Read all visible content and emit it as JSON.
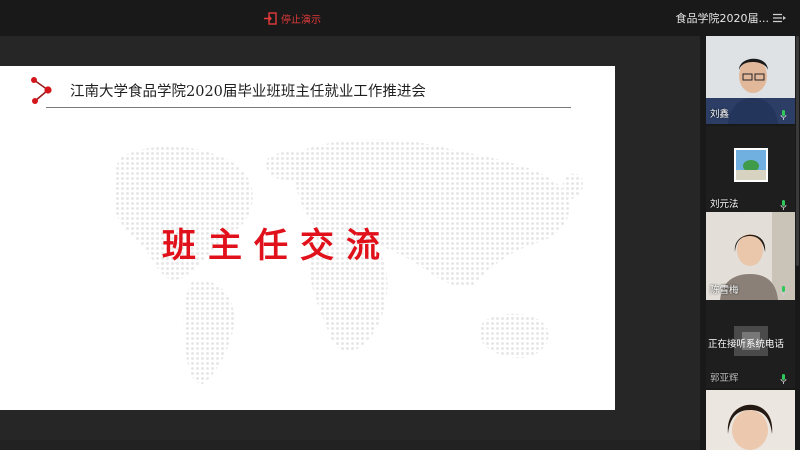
{
  "toolbar": {
    "stop_presenting_label": "停止演示",
    "meeting_title": "食品学院2020届...",
    "accent_color": "#e33a3a"
  },
  "slide": {
    "header_title": "江南大学食品学院2020届毕业班班主任就业工作推进会",
    "main_text": "班主任交流",
    "main_color": "#e0111a"
  },
  "participants": [
    {
      "name": "刘鑫",
      "mic": "on"
    },
    {
      "name": "刘元法",
      "mic": "on"
    },
    {
      "name": "陈雪梅",
      "mic": "on"
    },
    {
      "name": "郭亚辉",
      "mic": "on",
      "status": "正在接听系统电话"
    },
    {
      "name": "",
      "mic": ""
    }
  ]
}
